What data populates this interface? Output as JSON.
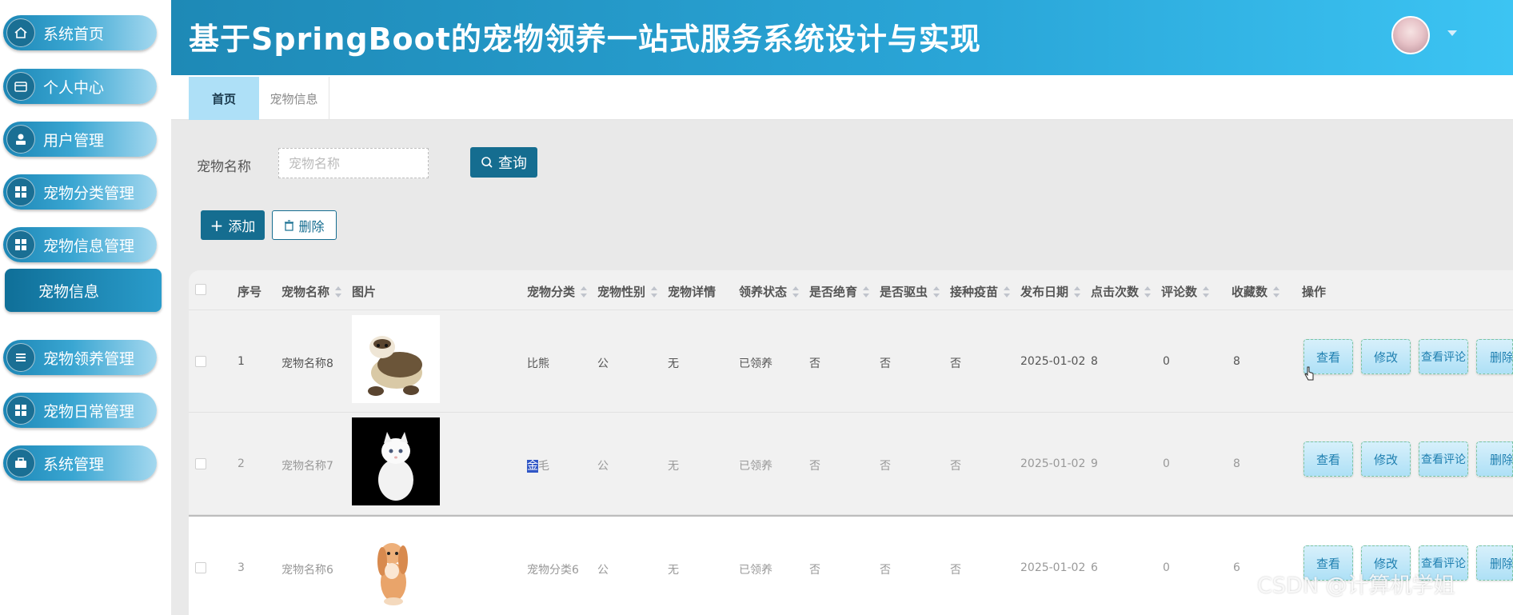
{
  "sidebar": {
    "items": [
      {
        "label": "系统首页",
        "icon": "home-icon"
      },
      {
        "label": "个人中心",
        "icon": "wallet-icon"
      },
      {
        "label": "用户管理",
        "icon": "user-icon"
      },
      {
        "label": "宠物分类管理",
        "icon": "grid-icon"
      },
      {
        "label": "宠物信息管理",
        "icon": "grid-icon"
      },
      {
        "label": "宠物信息",
        "icon": ""
      },
      {
        "label": "宠物领养管理",
        "icon": "list-icon"
      },
      {
        "label": "宠物日常管理",
        "icon": "grid-icon"
      },
      {
        "label": "系统管理",
        "icon": "briefcase-icon"
      }
    ]
  },
  "header": {
    "title": "基于SpringBoot的宠物领养一站式服务系统设计与实现"
  },
  "tabs": [
    {
      "label": "首页",
      "active": true
    },
    {
      "label": "宠物信息",
      "active": false
    }
  ],
  "search": {
    "label": "宠物名称",
    "placeholder": "宠物名称",
    "button": "查询"
  },
  "actions": {
    "add": "添加",
    "delete": "删除"
  },
  "table": {
    "columns": [
      "序号",
      "宠物名称",
      "图片",
      "宠物分类",
      "宠物性别",
      "宠物详情",
      "领养状态",
      "是否绝育",
      "是否驱虫",
      "接种疫苗",
      "发布日期",
      "点击次数",
      "评论数",
      "收藏数",
      "操作"
    ],
    "rows": [
      {
        "index": "1",
        "name": "宠物名称8",
        "category": "比熊",
        "gender": "公",
        "detail": "无",
        "status": "已领养",
        "neutered": "否",
        "dewormed": "否",
        "vaccinated": "否",
        "date": "2025-01-02",
        "clicks": "8",
        "comments": "0",
        "favorites": "8"
      },
      {
        "index": "2",
        "name": "宠物名称7",
        "category_hl": "金",
        "category_rest": "毛",
        "gender": "公",
        "detail": "无",
        "status": "已领养",
        "neutered": "否",
        "dewormed": "否",
        "vaccinated": "否",
        "date": "2025-01-02",
        "clicks": "9",
        "comments": "0",
        "favorites": "8"
      },
      {
        "index": "3",
        "name": "宠物名称6",
        "category": "宠物分类6",
        "gender": "公",
        "detail": "无",
        "status": "已领养",
        "neutered": "否",
        "dewormed": "否",
        "vaccinated": "否",
        "date": "2025-01-02",
        "clicks": "6",
        "comments": "0",
        "favorites": "6"
      }
    ],
    "ops": {
      "view": "查看",
      "edit": "修改",
      "review": "查看评论",
      "remove": "删除"
    }
  },
  "watermark": "CSDN @计算机学姐",
  "colors": {
    "accent": "#156d90",
    "header_start": "#1e89b6",
    "header_end": "#3cc4f3"
  }
}
